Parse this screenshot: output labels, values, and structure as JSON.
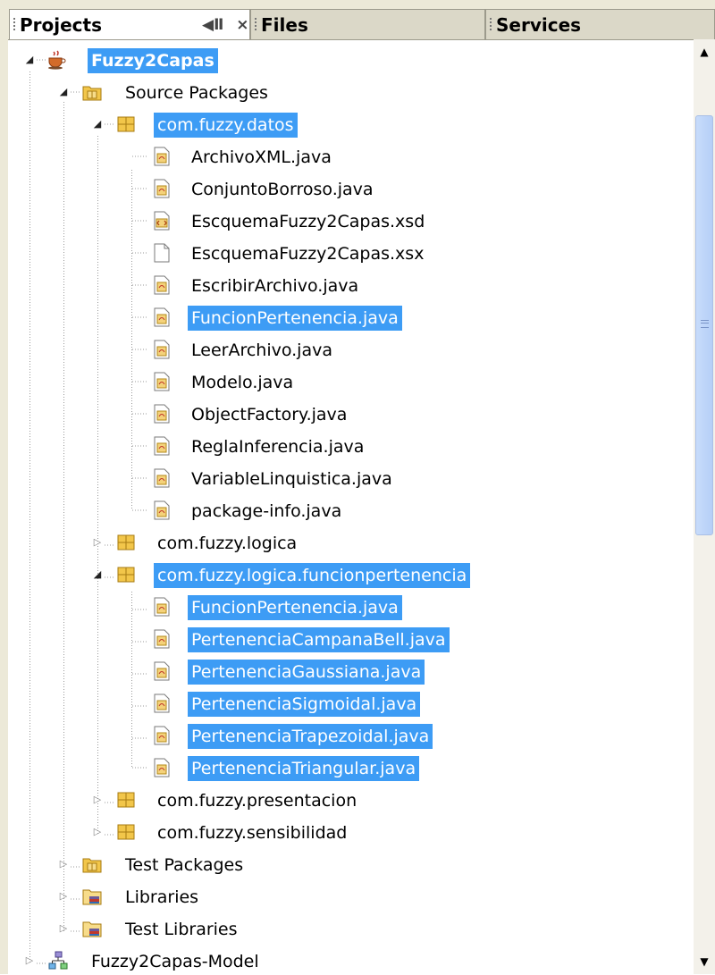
{
  "tabs": {
    "projects": "Projects",
    "files": "Files",
    "services": "Services"
  },
  "tab_controls": {
    "minimize_glyph": "◀Ⅱ",
    "close_glyph": "×"
  },
  "tree": {
    "project": "Fuzzy2Capas",
    "source_packages": "Source Packages",
    "pkg_datos": "com.fuzzy.datos",
    "datos_files": [
      "ArchivoXML.java",
      "ConjuntoBorroso.java",
      "EscquemaFuzzy2Capas.xsd",
      "EscquemaFuzzy2Capas.xsx",
      "EscribirArchivo.java",
      "FuncionPertenencia.java",
      "LeerArchivo.java",
      "Modelo.java",
      "ObjectFactory.java",
      "ReglaInferencia.java",
      "VariableLinquistica.java",
      "package-info.java"
    ],
    "pkg_logica": "com.fuzzy.logica",
    "pkg_funcionpertenencia": "com.fuzzy.logica.funcionpertenencia",
    "fp_files": [
      "FuncionPertenencia.java",
      "PertenenciaCampanaBell.java",
      "PertenenciaGaussiana.java",
      "PertenenciaSigmoidal.java",
      "PertenenciaTrapezoidal.java",
      "PertenenciaTriangular.java"
    ],
    "pkg_presentacion": "com.fuzzy.presentacion",
    "pkg_sensibilidad": "com.fuzzy.sensibilidad",
    "test_packages": "Test Packages",
    "libraries": "Libraries",
    "test_libraries": "Test Libraries",
    "project_model": "Fuzzy2Capas-Model"
  },
  "colors": {
    "selection": "#3d9cf5",
    "selection_text": "#ffffff",
    "tab_bar": "#ece9d8",
    "package_icon": "#f2c64a"
  },
  "icons": {
    "project": "coffee-cup-icon",
    "source_packages": "package-folder-icon",
    "package": "package-icon",
    "java_file": "java-file-icon",
    "xsd_file": "xml-schema-file-icon",
    "generic_file": "generic-file-icon",
    "library": "library-folder-icon",
    "model_project": "model-project-icon"
  }
}
